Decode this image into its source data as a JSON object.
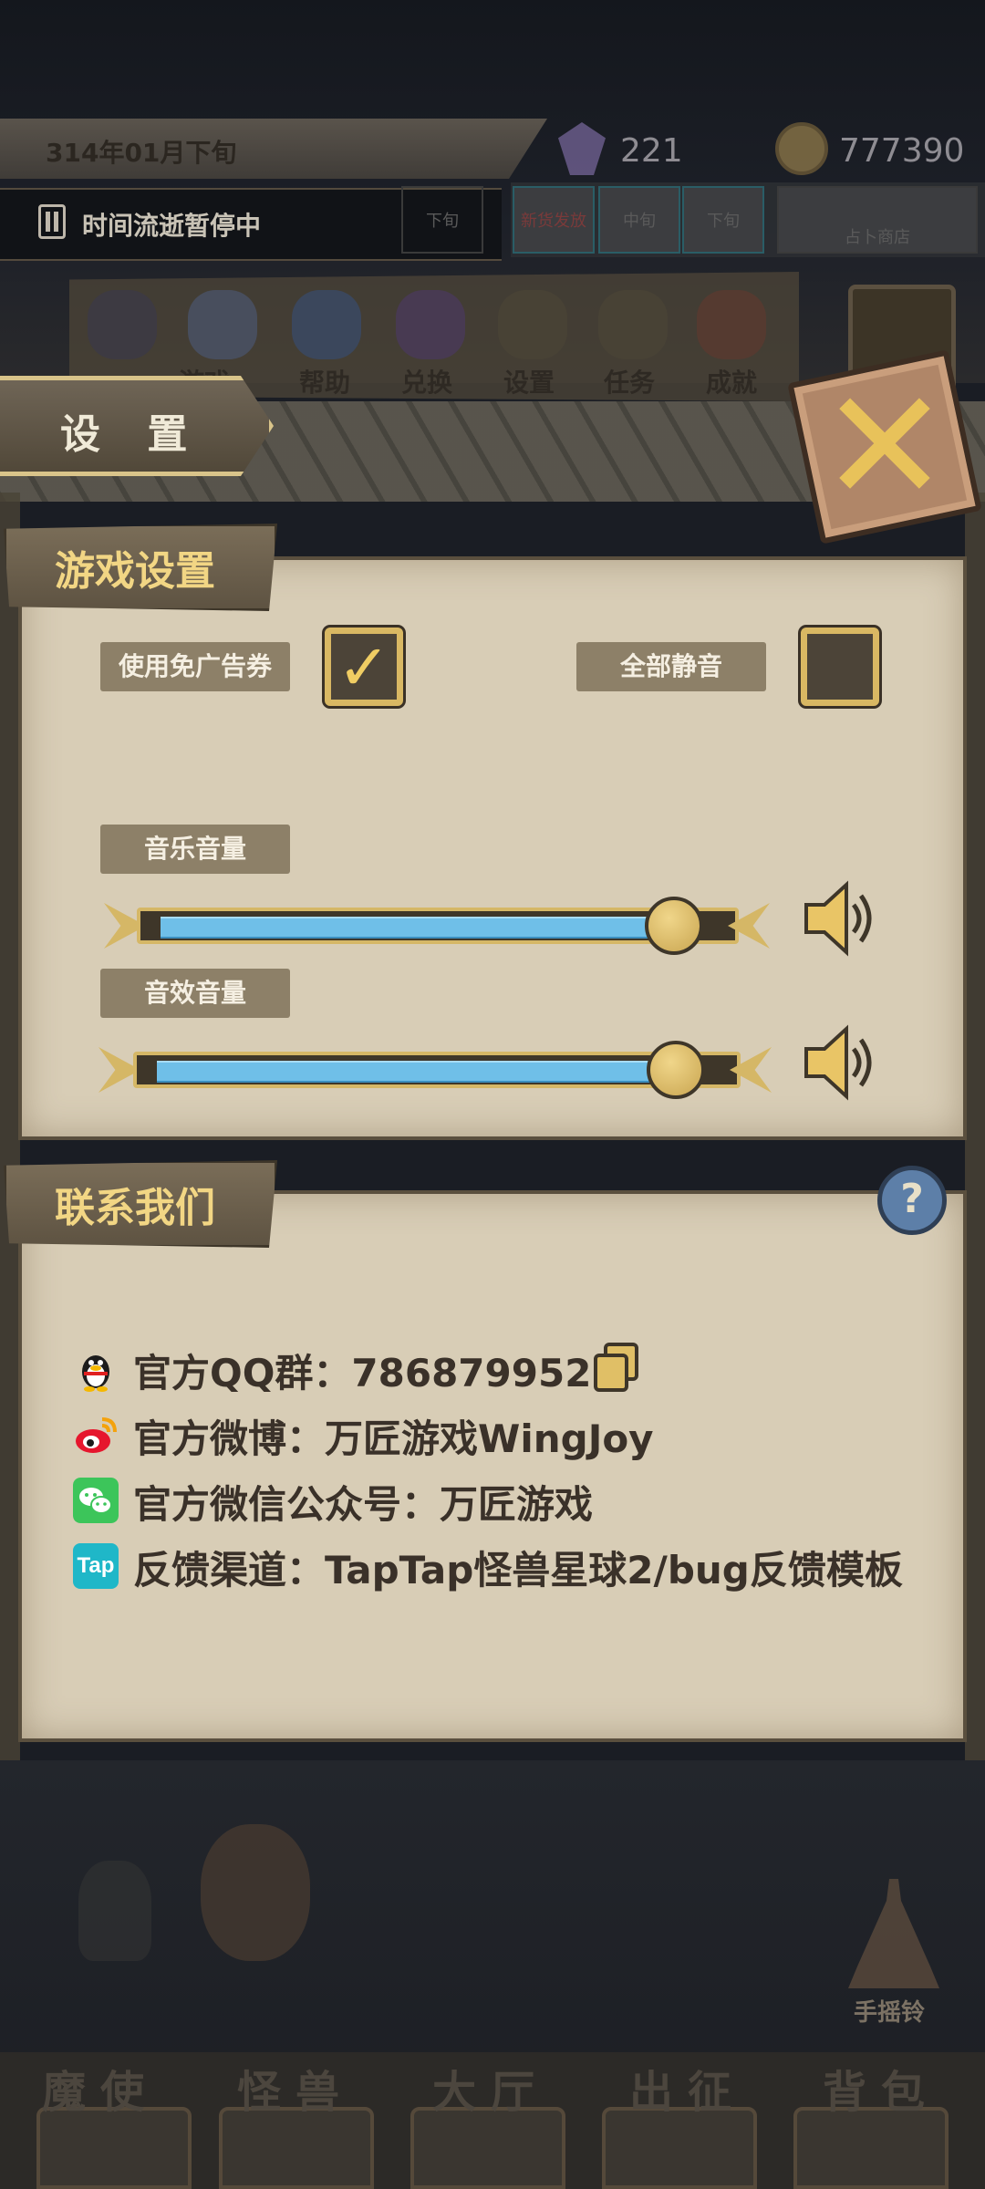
{
  "header": {
    "date": "314年01月下旬",
    "pause_status": "时间流逝暂停中",
    "crystal_count": "221",
    "coin_count": "777390",
    "shop_tabs": [
      "下旬",
      "新货发放",
      "中旬",
      "下旬",
      "占卜商店"
    ],
    "toolbar": [
      "游戏",
      "帮助",
      "兑换",
      "设置",
      "任务",
      "成就"
    ]
  },
  "dialog": {
    "title": "设 置",
    "close_icon": "close-x-icon"
  },
  "game_settings": {
    "section_title": "游戏设置",
    "ad_free_label": "使用免广告券",
    "ad_free_checked": true,
    "mute_all_label": "全部静音",
    "mute_all_checked": false,
    "music_volume_label": "音乐音量",
    "music_volume": 0.96,
    "sfx_volume_label": "音效音量",
    "sfx_volume": 0.96
  },
  "contact": {
    "section_title": "联系我们",
    "rows": [
      {
        "icon": "qq-icon",
        "text": "官方QQ群：786879952"
      },
      {
        "icon": "weibo-icon",
        "text": "官方微博：万匠游戏WingJoy"
      },
      {
        "icon": "wechat-icon",
        "text": "官方微信公众号：万匠游戏"
      },
      {
        "icon": "taptap-icon",
        "text": "反馈渠道：TapTap怪兽星球2/bug反馈模板"
      }
    ],
    "taptap_badge": "Tap"
  },
  "bottom": {
    "bell_label": "手摇铃",
    "nav": [
      "魔使",
      "怪兽",
      "大厅",
      "出征",
      "背包"
    ]
  },
  "colors": {
    "panel_bg": "#d8cdb6",
    "accent_gold": "#d9b863",
    "slider_blue": "#6fbfe8",
    "wechat_green": "#3cc55a",
    "taptap_cyan": "#1fb7c8"
  }
}
